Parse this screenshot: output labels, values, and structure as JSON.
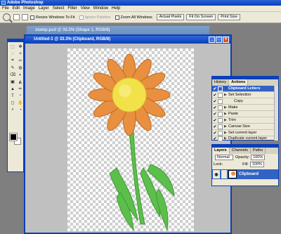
{
  "app": {
    "title": "Adobe Photoshop"
  },
  "menu": [
    "File",
    "Edit",
    "Image",
    "Layer",
    "Select",
    "Filter",
    "View",
    "Window",
    "Help"
  ],
  "options_bar": {
    "resize_windows_label": "Resize Windows To Fit",
    "ignore_palettes_label": "Ignore Palettes",
    "zoom_all_label": "Zoom All Windows",
    "actual_pixels": "Actual Pixels",
    "fit_on_screen": "Fit On Screen",
    "print_size": "Print Size"
  },
  "back_document": {
    "title": "stamp.psd @ 33.3% (Shape 1, RGB/8)"
  },
  "document": {
    "title": "Untitled-1 @ 33.3% (Clipboard, RGB/8)"
  },
  "toolbox": {
    "tools": [
      "⬚",
      "✥",
      "◌",
      "✧",
      "⌗",
      "✂",
      "✎",
      "◍",
      "⌫",
      "◐",
      "▣",
      "◭",
      "▲",
      "✏",
      "T",
      "⬞",
      "◻",
      "✋",
      "⌕",
      "◔"
    ]
  },
  "actions_panel": {
    "tabs": [
      "History",
      "Actions"
    ],
    "set_name": "Clipboard Letters",
    "items": [
      "Set Selection",
      "Copy",
      "Make",
      "Paste",
      "Trim",
      "Canvas Size",
      "Set current layer",
      "Duplicate current layer"
    ]
  },
  "layers_panel": {
    "tabs": [
      "Layers",
      "Channels",
      "Paths"
    ],
    "blend_mode": "Normal",
    "opacity_label": "Opacity:",
    "opacity_value": "100%",
    "lock_label": "Lock:",
    "fill_label": "Fill:",
    "fill_value": "100%",
    "layer_name": "Clipboard"
  },
  "colors": {
    "petal": "#e8903f",
    "center": "#f2e24a",
    "leaf": "#5cbf4b",
    "accent": "#0a3fb8"
  }
}
